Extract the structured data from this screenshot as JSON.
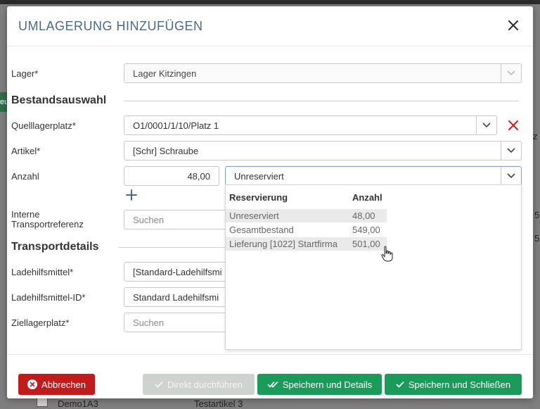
{
  "modal": {
    "title": "UMLAGERUNG HINZUFÜGEN"
  },
  "background": {
    "green_button_fragment": "eu",
    "row_text_left": "Demo1A3",
    "row_text_right": "Testartikel 3",
    "side_fragment_1": "5",
    "side_fragment_2": "5",
    "side_fragment_3": "z"
  },
  "form": {
    "lager": {
      "label": "Lager*",
      "value": "Lager Kitzingen"
    },
    "section_bestand": "Bestandsauswahl",
    "quelllagerplatz": {
      "label": "Quelllagerplatz*",
      "value": "O1/0001/1/10/Platz 1"
    },
    "artikel": {
      "label": "Artikel*",
      "value": "[Schr] Schraube"
    },
    "anzahl": {
      "label": "Anzahl",
      "value": "48,00",
      "reservation_value": "Unreserviert"
    },
    "transportreferenz": {
      "label_line1": "Interne",
      "label_line2": "Transportreferenz",
      "placeholder": "Suchen"
    },
    "section_transport": "Transportdetails",
    "ladehilfsmittel": {
      "label": "Ladehilfsmittel*",
      "value": "[Standard-Ladehilfsmi"
    },
    "ladehilfsmittel_id": {
      "label": "Ladehilfsmittel-ID*",
      "value": "Standard Ladehilfsmi"
    },
    "ziellagerplatz": {
      "label": "Ziellagerplatz*",
      "placeholder": "Suchen"
    }
  },
  "dropdown": {
    "headers": {
      "reservierung": "Reservierung",
      "anzahl": "Anzahl"
    },
    "rows": [
      {
        "reservierung": "Unreserviert",
        "anzahl": "48,00"
      },
      {
        "reservierung": "Gesamtbestand",
        "anzahl": "549,00"
      },
      {
        "reservierung": "Lieferung [1022] Startfirma",
        "anzahl": "501,00"
      }
    ]
  },
  "footer": {
    "cancel": "Abbrechen",
    "direct": "Direkt durchführen",
    "save_details": "Speichern und Details",
    "save_close": "Speichern und Schließen"
  },
  "colors": {
    "title": "#4a6a8c",
    "danger": "#c01c1c",
    "success": "#1a9b5a",
    "disabled": "#cfd3d0"
  }
}
